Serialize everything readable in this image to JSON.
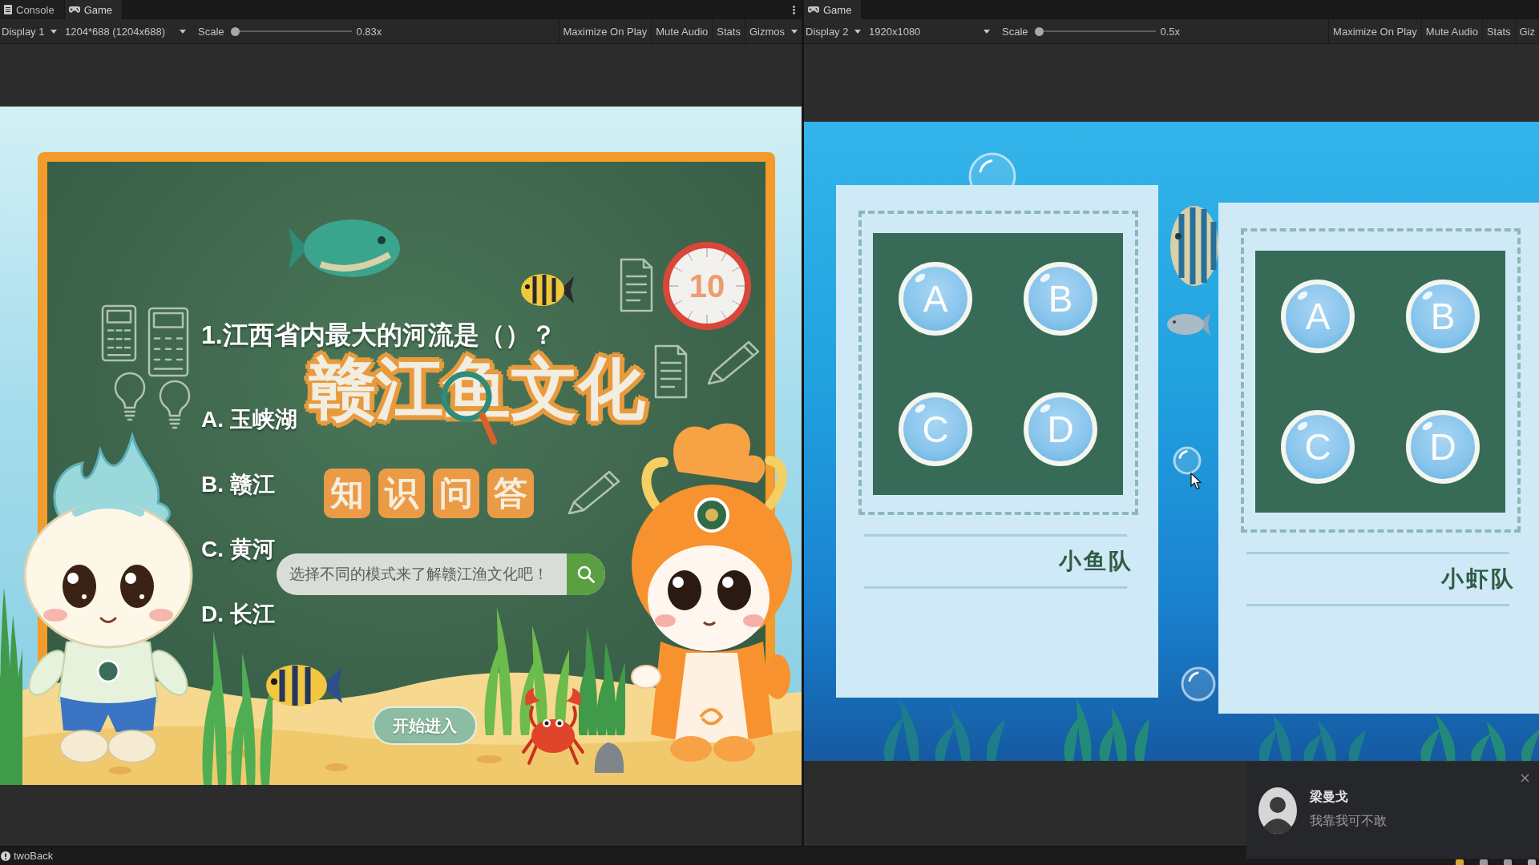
{
  "panes": [
    {
      "tabs": [
        {
          "kind": "console",
          "label": "Console",
          "selected": false
        },
        {
          "kind": "game",
          "label": "Game",
          "selected": true
        }
      ],
      "more_menu": true,
      "toolbar": {
        "display": "Display 1",
        "resolution": "1204*688 (1204x688)",
        "scale_label": "Scale",
        "scale": {
          "level": 0
        },
        "scale_value": "0.83x",
        "buttons": [
          {
            "label": "Maximize On Play",
            "dropdown": false
          },
          {
            "label": "Mute Audio",
            "dropdown": false
          },
          {
            "label": "Stats",
            "dropdown": false
          },
          {
            "label": "Gizmos",
            "dropdown": true
          }
        ]
      },
      "game": {
        "kind": "quiz",
        "logo": "赣江鱼文化",
        "subtitle_tiles": [
          "知",
          "识",
          "问",
          "答"
        ],
        "timer": "10",
        "question": "1.江西省内最大的河流是（）？",
        "options": [
          "A. 玉峡湖",
          "B. 赣江",
          "C. 黄河",
          "D. 长江"
        ],
        "search": {
          "placeholder": "选择不同的模式来了解赣江渔文化吧！"
        },
        "start_button": "开始进入"
      }
    },
    {
      "tabs": [
        {
          "kind": "game",
          "label": "Game",
          "selected": true
        }
      ],
      "more_menu": false,
      "toolbar": {
        "display": "Display 2",
        "resolution": "1920x1080",
        "scale_label": "Scale",
        "scale": {
          "level": 0
        },
        "scale_value": "0.5x",
        "buttons": [
          {
            "label": "Maximize On Play",
            "dropdown": false
          },
          {
            "label": "Mute Audio",
            "dropdown": false
          },
          {
            "label": "Stats",
            "dropdown": false
          },
          {
            "label": "Giz",
            "dropdown": false
          }
        ]
      },
      "game": {
        "kind": "teams",
        "teams": [
          {
            "name": "小鱼队",
            "answers": [
              "A",
              "B",
              "C",
              "D"
            ]
          },
          {
            "name": "小虾队",
            "answers": [
              "A",
              "B",
              "C",
              "D"
            ]
          }
        ]
      }
    }
  ],
  "status_bar": {
    "message": "twoBack"
  },
  "notification": {
    "name": "梁曼戈",
    "message": "我靠我可不敢"
  }
}
